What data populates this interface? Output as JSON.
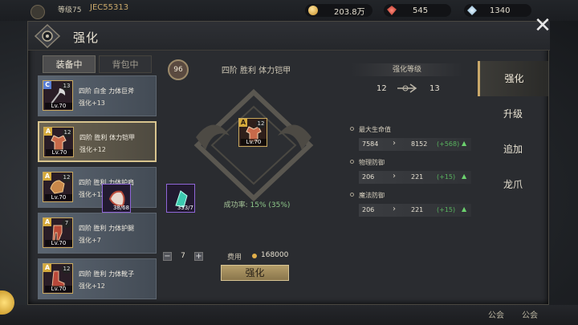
{
  "hud": {
    "player_level": "等级75",
    "player_id": "JEC55313",
    "gold": "203.8万",
    "ruby": "545",
    "diamond": "1340"
  },
  "panel": {
    "title": "强化",
    "close_label": "✕"
  },
  "tabs": {
    "equipped": "装备中",
    "bag": "背包中"
  },
  "items": [
    {
      "grade": "C",
      "plus": "13",
      "level": "Lv.70",
      "name": "四阶 白金 力体巨斧",
      "enhance": "强化+13"
    },
    {
      "grade": "A",
      "plus": "12",
      "level": "Lv.70",
      "name": "四阶 胜利 体力铠甲",
      "enhance": "强化+12"
    },
    {
      "grade": "A",
      "plus": "12",
      "level": "Lv.70",
      "name": "四阶 胜利 力体护肩",
      "enhance": "强化+12"
    },
    {
      "grade": "A",
      "plus": "7",
      "level": "Lv.70",
      "name": "四阶 胜利 力体护腿",
      "enhance": "强化+7"
    },
    {
      "grade": "A",
      "plus": "12",
      "level": "Lv.70",
      "name": "四阶 胜利 力体靴子",
      "enhance": "强化+12"
    }
  ],
  "center": {
    "level_badge": "96",
    "title": "四阶 胜利 体力铠甲",
    "item_grade": "A",
    "item_plus": "12",
    "item_level": "Lv.70",
    "success_label": "成功率:",
    "success_value": "15% (35%)",
    "material_stone_count": "38/68",
    "material_crystal_count": "333/7",
    "stepper_minus": "−",
    "stepper_value": "7",
    "stepper_plus": "+",
    "fee_label": "费用",
    "fee_value": "168000",
    "enhance_button": "强化"
  },
  "enhance_level": {
    "title": "强化等级",
    "from": "12",
    "to": "13"
  },
  "stats": [
    {
      "name": "最大生命值",
      "old": "7584",
      "new": "8152",
      "inc": "(+568)"
    },
    {
      "name": "物理防御",
      "old": "206",
      "new": "221",
      "inc": "(+15)"
    },
    {
      "name": "魔法防御",
      "old": "206",
      "new": "221",
      "inc": "(+15)"
    }
  ],
  "side_tabs": [
    "强化",
    "升级",
    "追加",
    "龙爪"
  ],
  "bottom": {
    "b1": "公会",
    "b2": "公会"
  },
  "colors": {
    "accent_gold": "#c9a86a",
    "positive_green": "#58b35e",
    "epic_purple": "#8f66d8"
  }
}
